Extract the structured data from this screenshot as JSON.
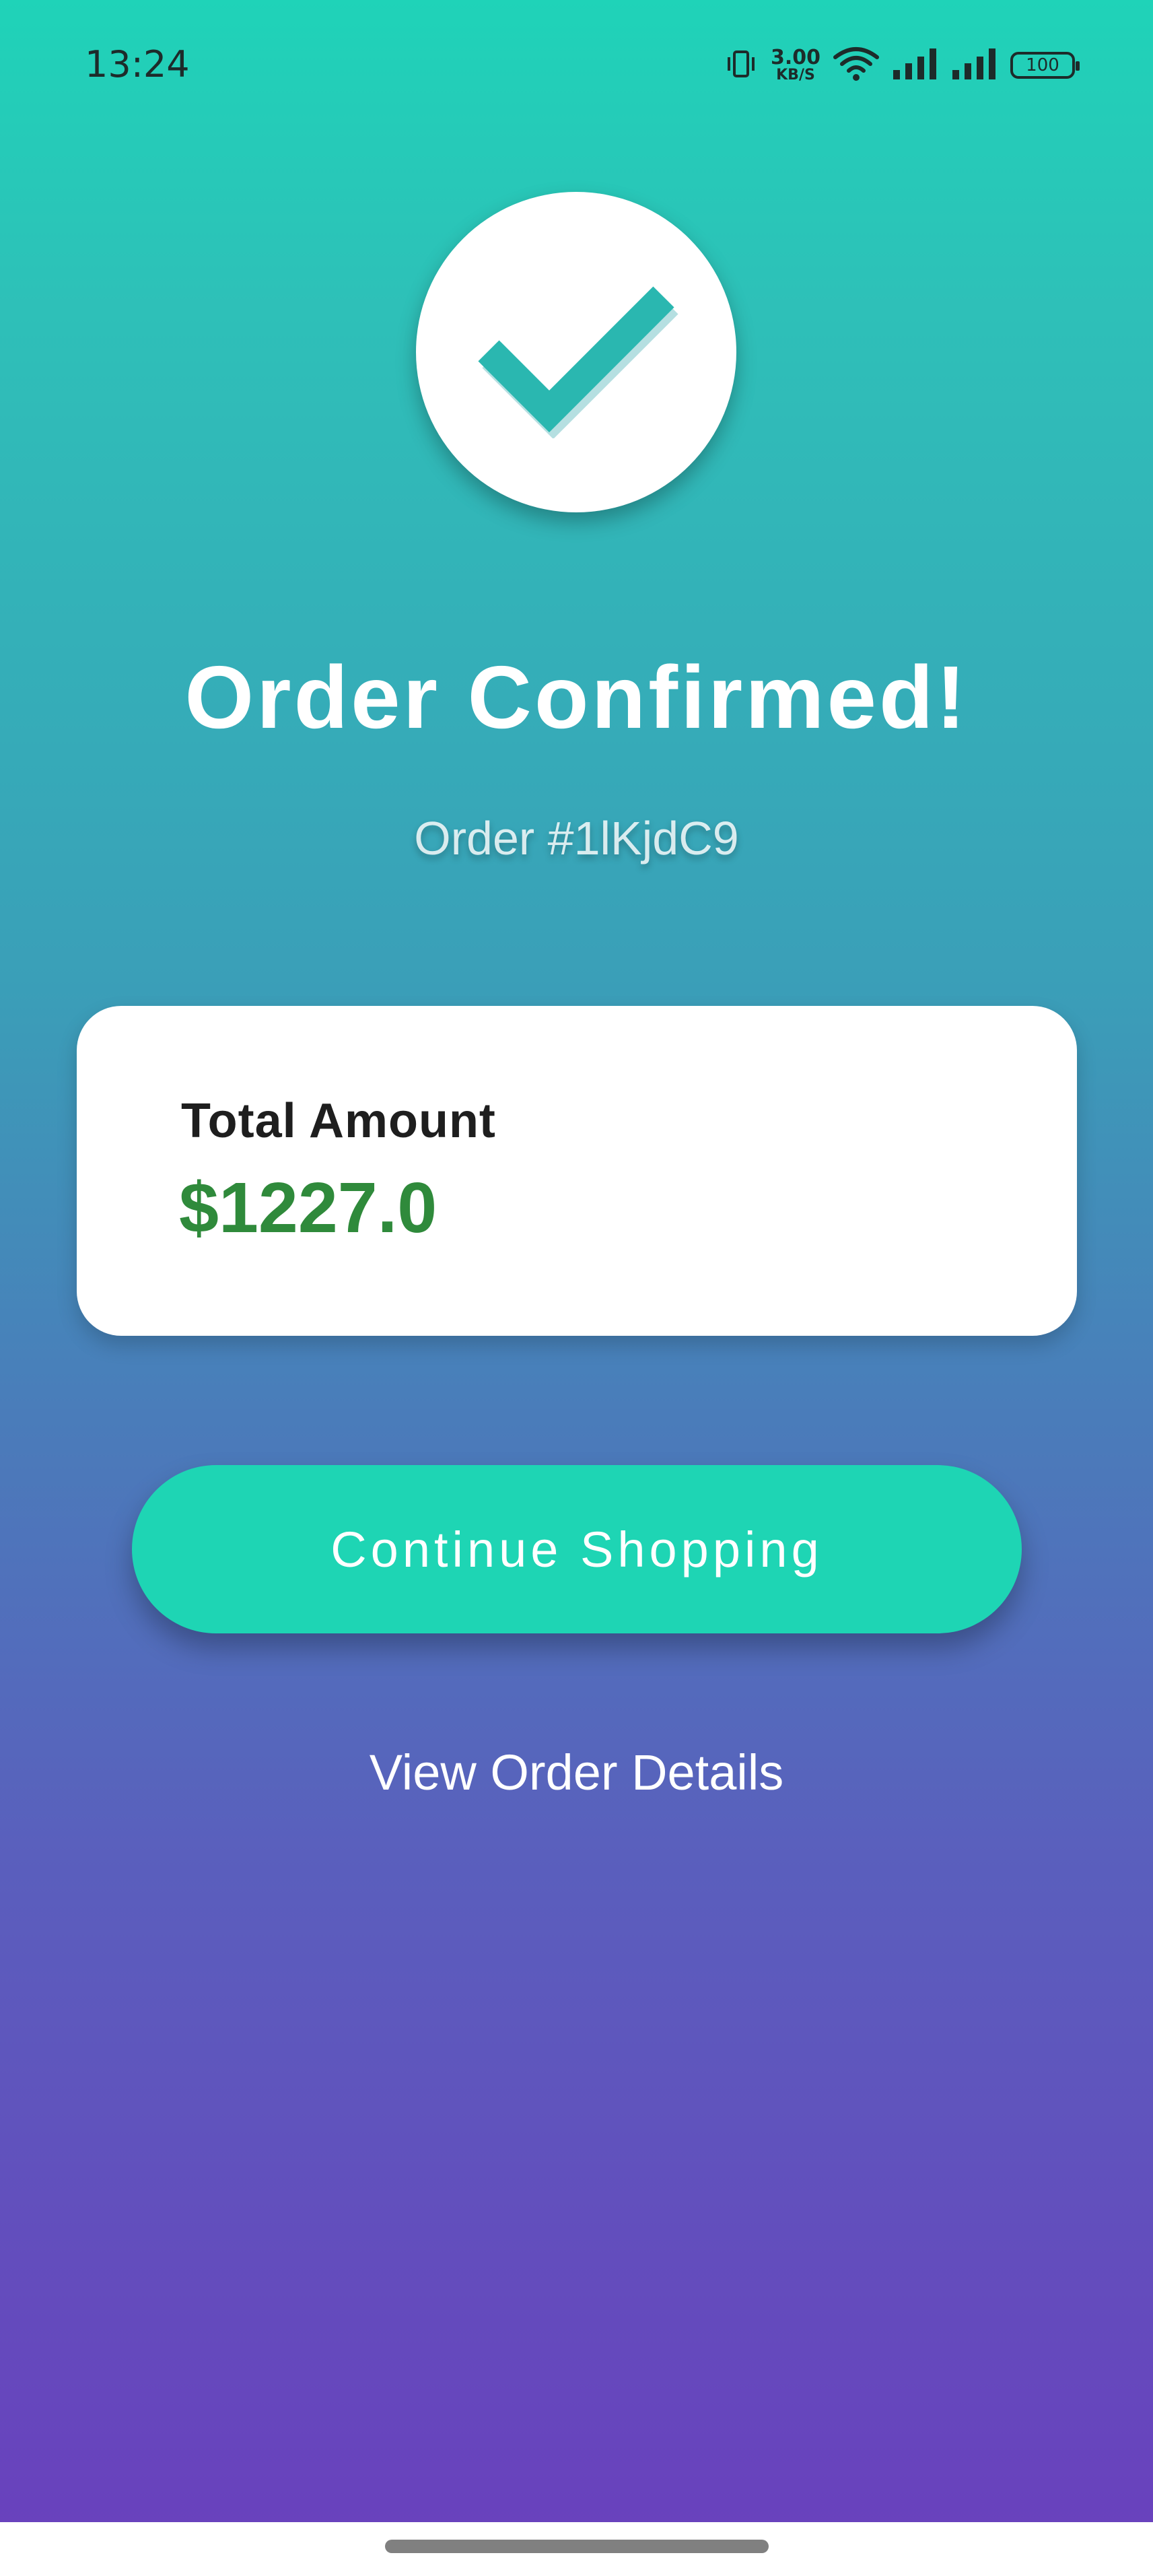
{
  "status_bar": {
    "time": "13:24",
    "net_speed_value": "3.00",
    "net_speed_unit": "KB/S",
    "battery": "100",
    "icons": [
      "vibrate-icon",
      "wifi-icon",
      "signal-icon",
      "signal-icon",
      "battery-icon"
    ]
  },
  "confirmation": {
    "icon": "check-icon",
    "title": "Order Confirmed!",
    "order_number": "Order #1lKjdC9"
  },
  "total_card": {
    "label": "Total Amount",
    "amount": "$1227.0",
    "amount_color": "#2f8a3b"
  },
  "actions": {
    "continue_label": "Continue Shopping",
    "view_details_label": "View Order Details"
  },
  "colors": {
    "gradient_top": "#1fd3b8",
    "gradient_bottom": "#6a3fbd",
    "button": "#1ed5b4"
  }
}
